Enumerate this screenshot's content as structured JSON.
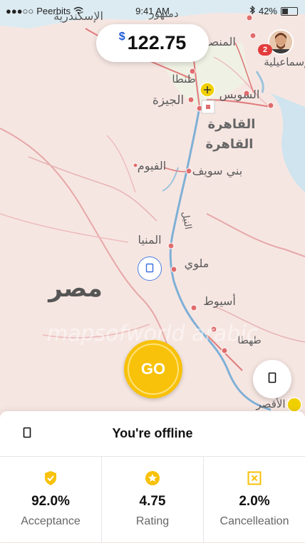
{
  "status_bar": {
    "signal": "●●●○○",
    "carrier": "Peerbits",
    "time": "9:41 AM",
    "battery": "42%",
    "battery_level": 0.42
  },
  "earnings": {
    "currency_symbol": "$",
    "amount": "122.75"
  },
  "notifications": {
    "count": "2"
  },
  "map": {
    "labels": {
      "country": "مصر",
      "cairo1": "القاهرة",
      "cairo2": "القاهرة",
      "giza": "الجيزة",
      "suez": "السويس",
      "fayoum": "الفيوم",
      "beni_suef": "بني سويف",
      "minya": "المنيا",
      "mallawi": "ملوي",
      "asyut": "أسيوط",
      "mansoura": "المنصورة",
      "alex": "الإسكندرية",
      "damanhur": "دمنهور",
      "tanta": "طنطا",
      "ismailia": "الإسماعيلية",
      "nile": "النيل",
      "luxor": "الأقصر",
      "tahta": "طهطا",
      "watermark": "mapsofworld arabic"
    }
  },
  "go_button": {
    "label": "GO"
  },
  "panel": {
    "title": "You're offline",
    "stats": [
      {
        "value": "92.0%",
        "label": "Acceptance",
        "icon": "shield-check-icon",
        "color": "#f8c10a"
      },
      {
        "value": "4.75",
        "label": "Rating",
        "icon": "star-badge-icon",
        "color": "#f8c10a"
      },
      {
        "value": "2.0%",
        "label": "Cancelleation",
        "icon": "x-square-icon",
        "color": "#f8c10a"
      }
    ]
  },
  "colors": {
    "accent": "#f8c10a",
    "currency": "#1e5bd8",
    "badge": "#e23b3b"
  }
}
